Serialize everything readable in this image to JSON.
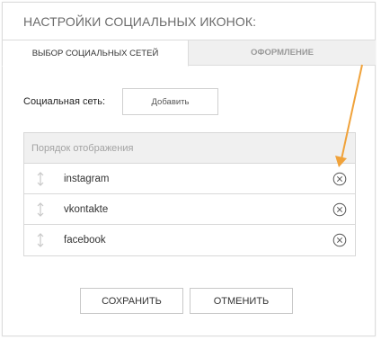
{
  "dialog": {
    "title": "НАСТРОЙКИ СОЦИАЛЬНЫХ ИКОНОК:"
  },
  "tabs": [
    {
      "label": "ВЫБОР СОЦИАЛЬНЫХ СЕТЕЙ",
      "active": true
    },
    {
      "label": "ОФОРМЛЕНИЕ",
      "active": false
    }
  ],
  "network_picker": {
    "label": "Социальная сеть:",
    "add_label": "Добавить"
  },
  "list": {
    "header": "Порядок отображения",
    "items": [
      {
        "name": "instagram"
      },
      {
        "name": "vkontakte"
      },
      {
        "name": "facebook"
      }
    ]
  },
  "icons": {
    "drag": "drag-handle-icon",
    "remove": "remove-circle-icon"
  },
  "actions": {
    "save_label": "СОХРАНИТЬ",
    "cancel_label": "ОТМЕНИТЬ"
  },
  "colors": {
    "annotation_arrow": "#f0a23a"
  }
}
